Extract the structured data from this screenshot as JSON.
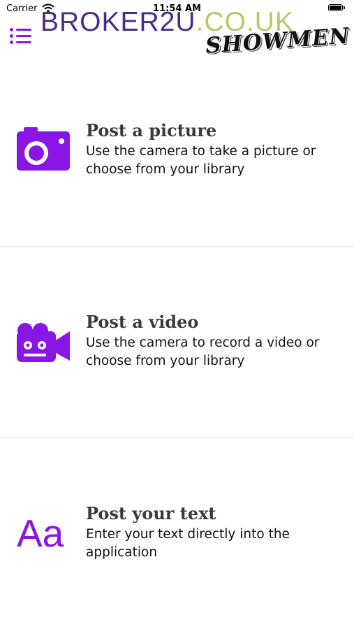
{
  "status_bar": {
    "carrier": "Carrier",
    "time": "11:54 AM"
  },
  "header": {
    "logo_part1": "BROKER2U",
    "logo_part2": ".CO.UK",
    "tagline": "SHOWMEN"
  },
  "options": [
    {
      "title": "Post a picture",
      "description": "Use the camera to take a picture or choose from your library",
      "icon": "camera-icon"
    },
    {
      "title": "Post a video",
      "description": "Use the camera to record a video or choose from your library",
      "icon": "video-camera-icon"
    },
    {
      "title": "Post your text",
      "description": "Enter your text directly into the application",
      "icon": "text-icon",
      "icon_text": "Aa"
    }
  ],
  "colors": {
    "accent": "#8a16e6",
    "logo_dark": "#4a2b8a",
    "logo_light": "#b7c76a",
    "divider": "#e6e6e6"
  }
}
